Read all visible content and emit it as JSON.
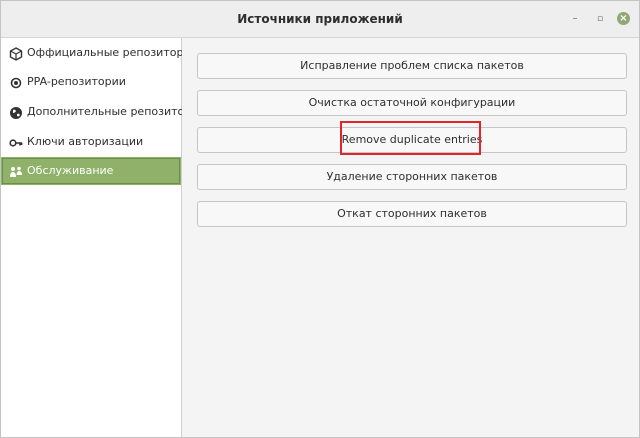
{
  "window": {
    "title": "Источники приложений",
    "controls": {
      "minimize": "–",
      "maximize": "▫",
      "close": "×"
    }
  },
  "sidebar": {
    "items": [
      {
        "label": "Оффициальные репозитории",
        "icon": "package-icon",
        "active": false
      },
      {
        "label": "PPA-репозитории",
        "icon": "ppa-icon",
        "active": false
      },
      {
        "label": "Дополнительные репозитории",
        "icon": "globe-icon",
        "active": false
      },
      {
        "label": "Ключи авторизации",
        "icon": "key-icon",
        "active": false
      },
      {
        "label": "Обслуживание",
        "icon": "maintenance-icon",
        "active": true
      }
    ]
  },
  "main": {
    "buttons": [
      {
        "label": "Исправление проблем списка пакетов"
      },
      {
        "label": "Очистка остаточной конфигурации"
      },
      {
        "label": "Remove duplicate entries"
      },
      {
        "label": "Удаление сторонних пакетов"
      },
      {
        "label": "Откат сторонних пакетов"
      }
    ]
  },
  "colors": {
    "accent": "#8fb16a",
    "highlight": "#e0262a"
  }
}
